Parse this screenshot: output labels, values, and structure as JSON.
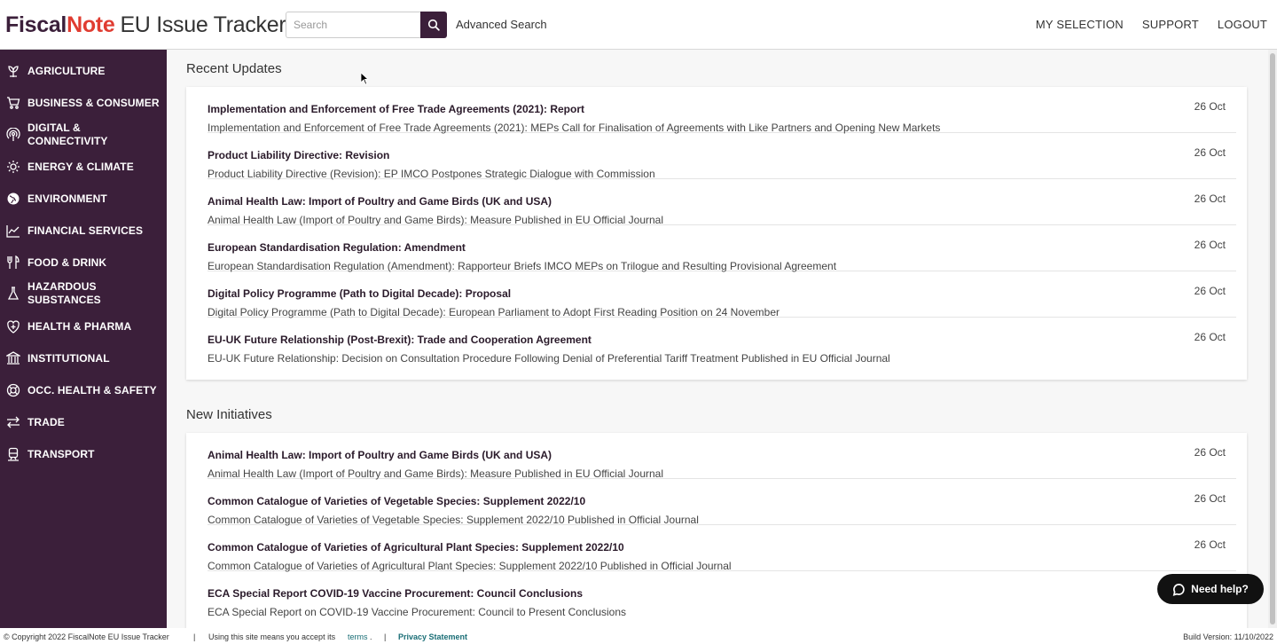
{
  "header": {
    "logo_fiscal": "Fiscal",
    "logo_note": "Note",
    "logo_product": "EU Issue Tracker",
    "search_placeholder": "Search",
    "advanced_search": "Advanced Search",
    "nav": [
      "MY SELECTION",
      "SUPPORT",
      "LOGOUT"
    ]
  },
  "sidebar": {
    "items": [
      {
        "label": "AGRICULTURE",
        "icon": "wheat-icon"
      },
      {
        "label": "BUSINESS & CONSUMER",
        "icon": "cart-icon"
      },
      {
        "label": "DIGITAL & CONNECTIVITY",
        "icon": "signal-icon"
      },
      {
        "label": "ENERGY & CLIMATE",
        "icon": "sun-icon"
      },
      {
        "label": "ENVIRONMENT",
        "icon": "globe-icon"
      },
      {
        "label": "FINANCIAL SERVICES",
        "icon": "chart-icon"
      },
      {
        "label": "FOOD & DRINK",
        "icon": "cutlery-icon"
      },
      {
        "label": "HAZARDOUS SUBSTANCES",
        "icon": "flask-icon"
      },
      {
        "label": "HEALTH & PHARMA",
        "icon": "heart-shield-icon"
      },
      {
        "label": "INSTITUTIONAL",
        "icon": "building-icon"
      },
      {
        "label": "OCC. HEALTH & SAFETY",
        "icon": "lifebuoy-icon"
      },
      {
        "label": "TRADE",
        "icon": "arrows-icon"
      },
      {
        "label": "TRANSPORT",
        "icon": "train-icon"
      }
    ]
  },
  "recent_updates": {
    "title": "Recent Updates",
    "items": [
      {
        "title": "Implementation and Enforcement of Free Trade Agreements (2021): Report",
        "summary": "Implementation and Enforcement of Free Trade Agreements (2021): MEPs Call for Finalisation of Agreements with Like Partners and Opening New Markets",
        "date": "26 Oct"
      },
      {
        "title": "Product Liability Directive: Revision",
        "summary": "Product Liability Directive (Revision): EP IMCO Postpones Strategic Dialogue with Commission",
        "date": "26 Oct"
      },
      {
        "title": "Animal Health Law: Import of Poultry and Game Birds (UK and USA)",
        "summary": "Animal Health Law (Import of Poultry and Game Birds): Measure Published in EU Official Journal",
        "date": "26 Oct"
      },
      {
        "title": "European Standardisation Regulation: Amendment",
        "summary": "European Standardisation Regulation (Amendment): Rapporteur Briefs IMCO MEPs on Trilogue and Resulting Provisional Agreement",
        "date": "26 Oct"
      },
      {
        "title": "Digital Policy Programme (Path to Digital Decade): Proposal",
        "summary": "Digital Policy Programme (Path to Digital Decade): European Parliament to Adopt First Reading Position on 24 November",
        "date": "26 Oct"
      },
      {
        "title": "EU-UK Future Relationship (Post-Brexit): Trade and Cooperation Agreement",
        "summary": "EU-UK Future Relationship: Decision on Consultation Procedure Following Denial of Preferential Tariff Treatment Published in EU Official Journal",
        "date": "26 Oct"
      }
    ]
  },
  "new_initiatives": {
    "title": "New Initiatives",
    "items": [
      {
        "title": "Animal Health Law: Import of Poultry and Game Birds (UK and USA)",
        "summary": "Animal Health Law (Import of Poultry and Game Birds): Measure Published in EU Official Journal",
        "date": "26 Oct"
      },
      {
        "title": "Common Catalogue of Varieties of Vegetable Species: Supplement 2022/10",
        "summary": "Common Catalogue of Varieties of Vegetable Species: Supplement 2022/10 Published in Official Journal",
        "date": "26 Oct"
      },
      {
        "title": "Common Catalogue of Varieties of Agricultural Plant Species: Supplement 2022/10",
        "summary": "Common Catalogue of Varieties of Agricultural Plant Species: Supplement 2022/10 Published in Official Journal",
        "date": "26 Oct"
      },
      {
        "title": "ECA Special Report COVID-19 Vaccine Procurement: Council Conclusions",
        "summary": "ECA Special Report on COVID-19 Vaccine Procurement: Council to Present Conclusions",
        "date": ""
      }
    ]
  },
  "footer": {
    "copyright": "© Copyright 2022 FiscalNote EU Issue Tracker",
    "sep": "|",
    "terms_prefix": "Using this site means you accept its",
    "terms_link": "terms",
    "terms_suffix": ".",
    "privacy": "Privacy Statement",
    "build": "Build Version: 11/10/2022"
  },
  "help": {
    "label": "Need help?"
  },
  "colors": {
    "brand": "#3b1f3a",
    "logo_red": "#e03c31",
    "link": "#1a6e76"
  }
}
